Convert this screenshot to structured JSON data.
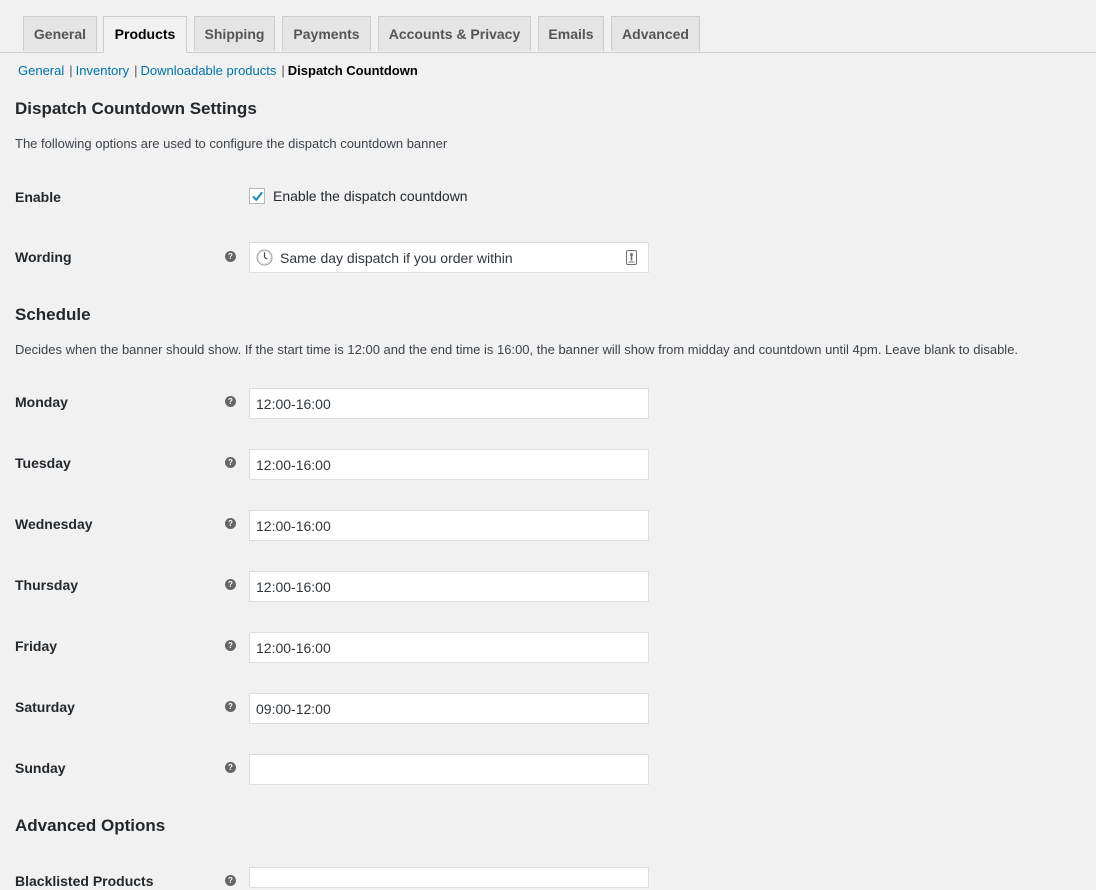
{
  "tabs": [
    {
      "label": "General",
      "active": false
    },
    {
      "label": "Products",
      "active": true
    },
    {
      "label": "Shipping",
      "active": false
    },
    {
      "label": "Payments",
      "active": false
    },
    {
      "label": "Accounts & Privacy",
      "active": false
    },
    {
      "label": "Emails",
      "active": false
    },
    {
      "label": "Advanced",
      "active": false
    }
  ],
  "subnav": {
    "items": [
      "General",
      "Inventory",
      "Downloadable products"
    ],
    "separator": "|",
    "current": "Dispatch Countdown"
  },
  "settings": {
    "title": "Dispatch Countdown Settings",
    "description": "The following options are used to configure the dispatch countdown banner",
    "enable": {
      "label": "Enable",
      "checkbox_label": "Enable the dispatch countdown",
      "checked": true
    },
    "wording": {
      "label": "Wording",
      "value": "Same day dispatch if you order within",
      "icon": "clock-icon"
    }
  },
  "schedule": {
    "title": "Schedule",
    "description": "Decides when the banner should show. If the start time is 12:00 and the end time is 16:00, the banner will show from midday and countdown until 4pm. Leave blank to disable.",
    "days": [
      {
        "label": "Monday",
        "value": "12:00-16:00"
      },
      {
        "label": "Tuesday",
        "value": "12:00-16:00"
      },
      {
        "label": "Wednesday",
        "value": "12:00-16:00"
      },
      {
        "label": "Thursday",
        "value": "12:00-16:00"
      },
      {
        "label": "Friday",
        "value": "12:00-16:00"
      },
      {
        "label": "Saturday",
        "value": "09:00-12:00"
      },
      {
        "label": "Sunday",
        "value": ""
      }
    ]
  },
  "advanced": {
    "title": "Advanced Options",
    "blacklisted": {
      "label": "Blacklisted Products",
      "value": ""
    }
  },
  "help_tip_glyph": "?",
  "colors": {
    "link": "#0073aa",
    "checkmark": "#1e8cbe",
    "background": "#f1f1f1"
  }
}
